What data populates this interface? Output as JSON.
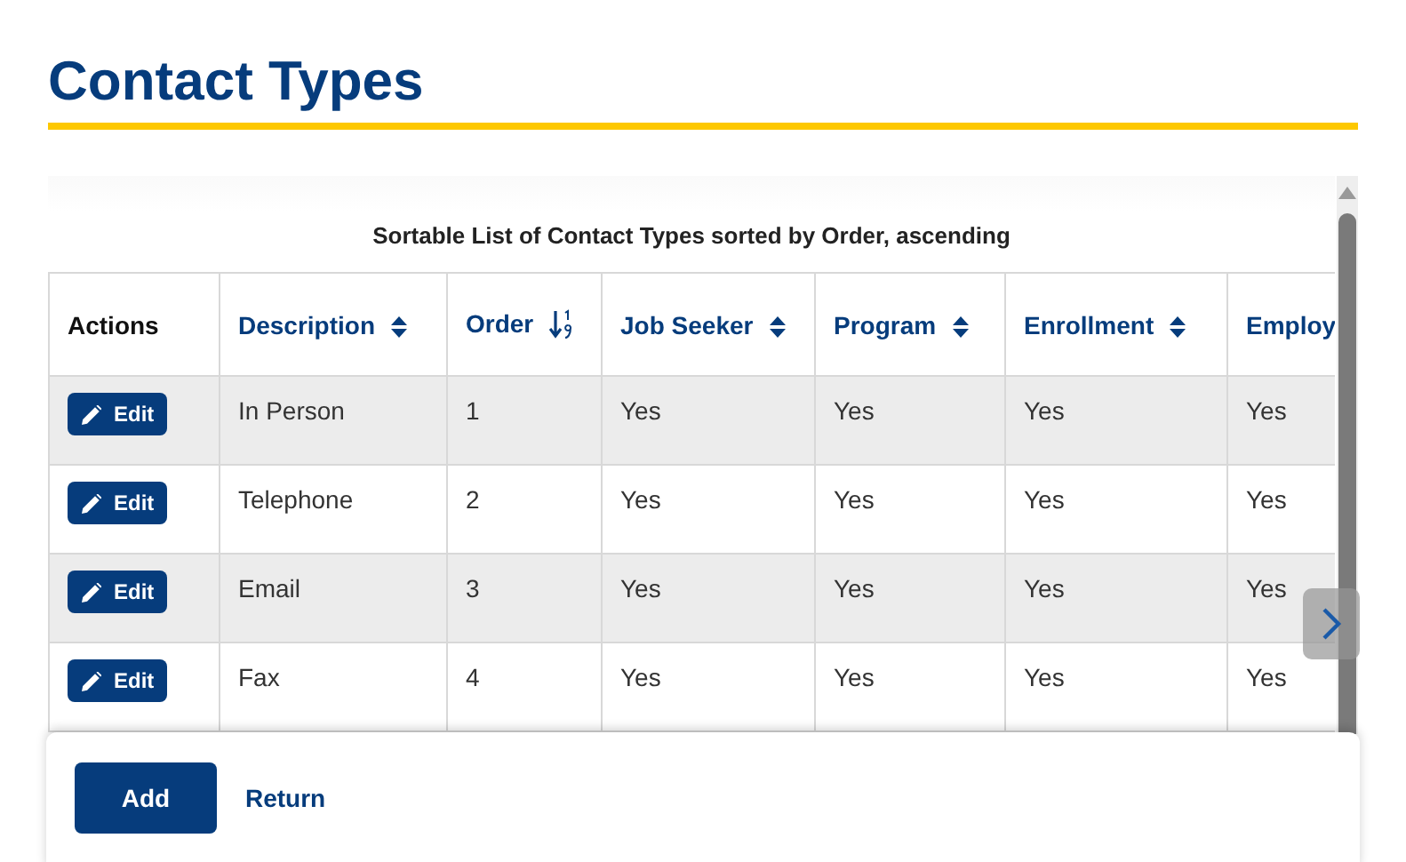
{
  "page_title": "Contact Types",
  "table": {
    "caption": "Sortable List of Contact Types sorted by Order, ascending",
    "columns": [
      {
        "label": "Actions",
        "sortable": false
      },
      {
        "label": "Description",
        "sortable": true,
        "sorted": false
      },
      {
        "label": "Order",
        "sortable": true,
        "sorted": true
      },
      {
        "label": "Job Seeker",
        "sortable": true,
        "sorted": false
      },
      {
        "label": "Program",
        "sortable": true,
        "sorted": false
      },
      {
        "label": "Enrollment",
        "sortable": true,
        "sorted": false
      },
      {
        "label": "Employ",
        "sortable": true
      }
    ],
    "rows": [
      {
        "cells": [
          "Edit",
          "In Person",
          "1",
          "Yes",
          "Yes",
          "Yes",
          "Yes"
        ]
      },
      {
        "cells": [
          "Edit",
          "Telephone",
          "2",
          "Yes",
          "Yes",
          "Yes",
          "Yes"
        ]
      },
      {
        "cells": [
          "Edit",
          "Email",
          "3",
          "Yes",
          "Yes",
          "Yes",
          "Yes"
        ]
      },
      {
        "cells": [
          "Edit",
          "Fax",
          "4",
          "Yes",
          "Yes",
          "Yes",
          "Yes"
        ]
      }
    ]
  },
  "footer": {
    "primary_button": "Add",
    "link": "Return"
  }
}
